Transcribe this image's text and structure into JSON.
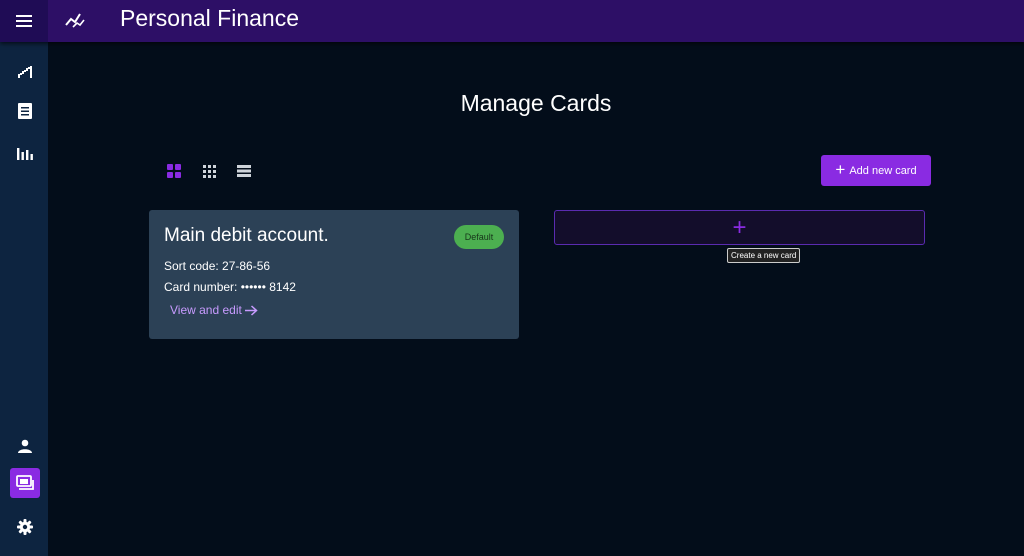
{
  "app": {
    "title": "Personal Finance"
  },
  "topbar": {
    "menu_icon": "menu-icon",
    "logo_icon": "sparkline-icon"
  },
  "sidebar": {
    "items": [
      {
        "icon": "trend-icon"
      },
      {
        "icon": "receipt-icon"
      },
      {
        "icon": "bar-chart-icon"
      },
      {
        "icon": "person-icon"
      },
      {
        "icon": "cards-icon",
        "active": true
      },
      {
        "icon": "gear-icon"
      }
    ]
  },
  "main": {
    "title": "Manage Cards",
    "view_options": [
      "large-grid-icon",
      "small-grid-icon",
      "list-icon"
    ],
    "add_button": {
      "label": "Add new card"
    },
    "cards": [
      {
        "name": "Main debit account.",
        "badge": "Default",
        "sort_code_label": "Sort code: 27-86-56",
        "card_number_label": "Card number: •••••• 8142",
        "link": "View and edit"
      }
    ],
    "new_card": {
      "tooltip": "Create a new card"
    }
  },
  "colors": {
    "accent": "#8a2be2",
    "topbar": "#2d0f66",
    "background": "#030d1a",
    "card": "#2c4156",
    "badge": "#4caf50"
  }
}
